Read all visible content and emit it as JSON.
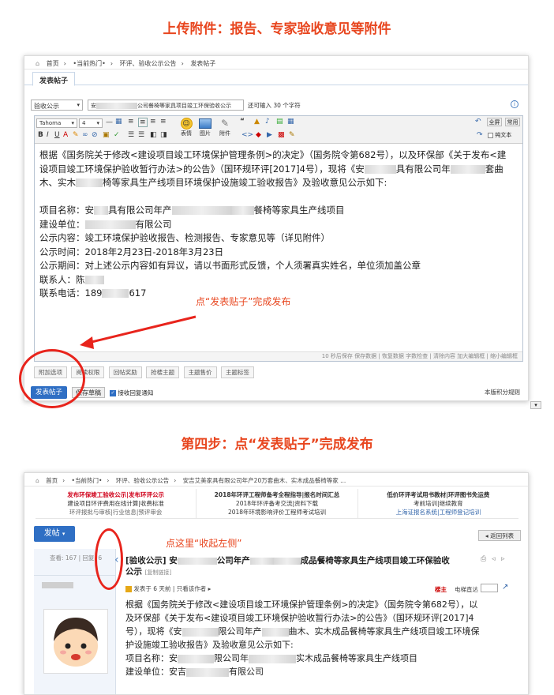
{
  "step3": {
    "title": "上传附件：报告、专家验收意见等附件",
    "breadcrumb": [
      "首页",
      "•当前热门•",
      "环评、验收公示公告",
      "发表帖子"
    ],
    "tab": "发表帖子",
    "category_select": "验收公示",
    "subject_prefix": "安",
    "subject_suffix": "公司餐椅等家具项目竣工环保验收公示",
    "char_hint": "还可输入 30 个字符",
    "toolbar": {
      "font": "Tahoma",
      "size": "4",
      "emoji": "表情",
      "image": "图片",
      "attach": "附件",
      "fullscreen": "全屏",
      "common": "常用",
      "plaintext": "纯文本"
    },
    "content": {
      "l1": "根据《国务院关于修改<建设项目竣工环境保护管理条例>的决定》（国务院令第682号），以及环保部《关于发布<建",
      "l2": "设项目竣工环境保护验收暂行办法>的公告》（国环规环评[2017]4号），现将《安",
      "l2b": "具有限公司年",
      "l2c": "套曲",
      "l3a": "木、实木",
      "l3b": "椅等家具生产线项目环境保护设施竣工验收报告》及验收意见公示如下:",
      "l4a": "项目名称：安",
      "l4b": "具有限公司年产",
      "l4c": "餐椅等家具生产线项目",
      "l5a": "建设单位：",
      "l5b": "有限公司",
      "l6": "公示内容：竣工环境保护验收报告、检测报告、专家意见等（详见附件）",
      "l7": "公示时间：2018年2月23日-2018年3月23日",
      "l8": "公示期间：对上述公示内容如有异议，请以书面形式反馈，个人须署真实姓名，单位须加盖公章",
      "l9": "联系人：陈",
      "l10a": "联系电话：189",
      "l10b": "617"
    },
    "statusbar": "10 秒后保存  保存数据 | 恢复数据    字数检查 | 清除内容    加大编辑框 | 缩小编辑框",
    "options": [
      "附加选项",
      "阅读权限",
      "回帖奖励",
      "抢楼主题",
      "主题售价",
      "主题标签"
    ],
    "submit": "发表帖子",
    "save_draft": "保存草稿",
    "receive_reply": "接收回复通知",
    "right_note": "本版积分规则",
    "annotation": "点“发表贴子”完成发布"
  },
  "step4": {
    "title": "第四步：点“发表贴子”完成发布",
    "breadcrumb": [
      "首页",
      "•当前热门•",
      "环评、验收公示公告",
      "安吉艾美家具有限公司年产20万套曲木、实木成品餐椅等家 ..."
    ],
    "nav": {
      "col1": [
        "发布环保竣工验收公示|发布环评公示",
        "建设项目环评费用在线计算|收费标准",
        "环评报批与审核|行业信息|预评审会"
      ],
      "col2": [
        "2018年环评工程师备考全程指导|报名时间汇总",
        "2018年环评备考交流|资料下载",
        "2018年环境影响评价工程师考试培训"
      ],
      "col3": [
        "低价环评考试用书教材|环评图书免运费",
        "考前培训|继续教育",
        "上海证报名系统|工程师登记培训"
      ]
    },
    "post_button": "发帖",
    "return_list": "返回列表",
    "stats": "查看: 167 | 回复: 6",
    "annotation": "点这里“收起左侧”",
    "thread_title_a": "[验收公示] 安",
    "thread_title_b": "公司年产",
    "thread_title_c": "成品餐椅等家具生产线项目竣工环保验收",
    "thread_title_d": "公示",
    "thread_copy": "[复制链接]",
    "post_meta": "发表于 6 天前 | 只看该作者",
    "floor": "楼主",
    "jump": "电梯直达",
    "body": {
      "l1": "根据《国务院关于修改<建设项目竣工环境保护管理条例>的决定》（国务院令第682号），以",
      "l2": "及环保部《关于发布<建设项目竣工环境保护验收暂行办法>的公告》（国环规环评[2017]4",
      "l3a": "号），现将《安",
      "l3b": "限公司年产",
      "l3c": "曲木、实木成品餐椅等家具生产线项目竣工环境保",
      "l4": "护设施竣工验收报告》及验收意见公示如下:",
      "l5a": "项目名称：安",
      "l5b": "限公司年",
      "l5c": "实木成品餐椅等家具生产线项目",
      "l6a": "建设单位：安吉",
      "l6b": "有限公司"
    }
  },
  "colors": {
    "accent": "#e8461f",
    "blue": "#2f6fc4",
    "ring": "#e8241c"
  }
}
